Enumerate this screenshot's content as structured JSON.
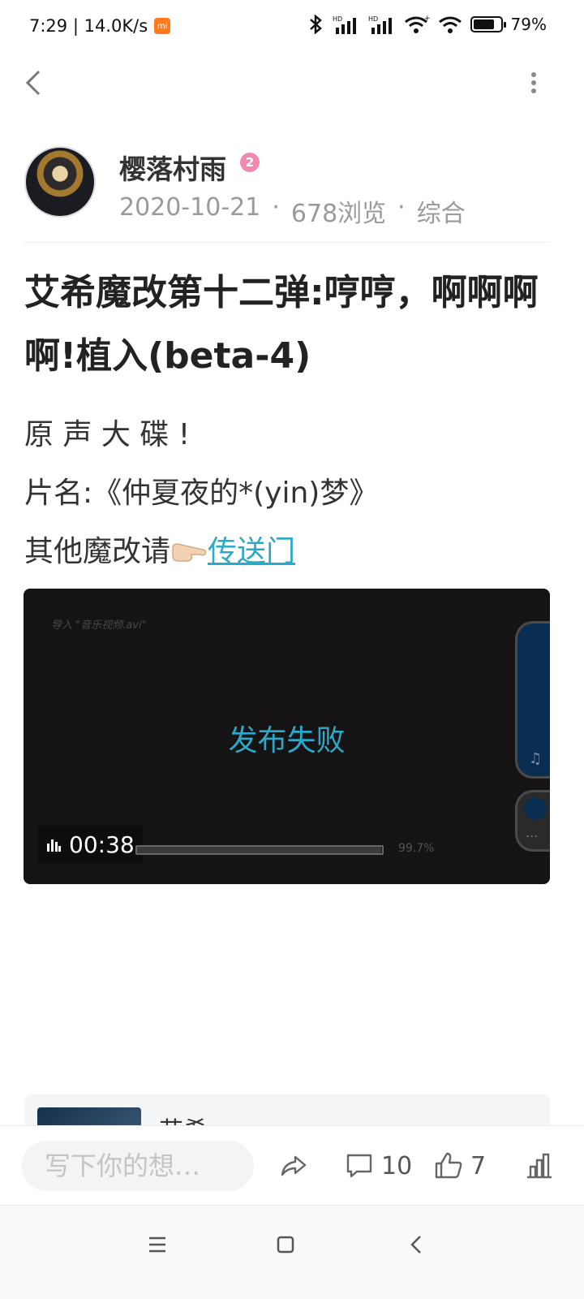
{
  "status_bar": {
    "time_speed": "7:29 | 14.0K/s",
    "mi_badge": "mi",
    "battery": "79%",
    "battery_level": 0.79
  },
  "author": {
    "name": "樱落村雨",
    "level": "2",
    "date": "2020-10-21",
    "views": "678浏览",
    "category": "综合",
    "separator": "·"
  },
  "post": {
    "title": "艾希魔改第十二弹:哼哼，啊啊啊啊!植入(beta-4)",
    "line1": "原 声 大 碟 !",
    "line2": "片名:《仲夏夜的*(yin)梦》",
    "line3_prefix": "其他魔改请",
    "line3_link": "传送门"
  },
  "video": {
    "import_text": "导入 \"音乐视频.avi\"",
    "status": "发布失败",
    "duration": "00:38",
    "progress_percent": "99.7%",
    "progress_fraction": 0.997,
    "side_more": "..."
  },
  "related": {
    "title": "艾希"
  },
  "actions": {
    "comment_placeholder": "写下你的想…",
    "comment_count": "10",
    "like_count": "7"
  },
  "icons": {
    "back": "chevron-left-icon",
    "more": "more-vertical-icon",
    "share": "share-icon",
    "comment": "comment-icon",
    "like": "thumbs-up-icon",
    "stats": "bar-chart-icon"
  },
  "colors": {
    "accent": "#2aa9c9",
    "level_badge": "#f08ab0",
    "video_bg": "#151314"
  }
}
